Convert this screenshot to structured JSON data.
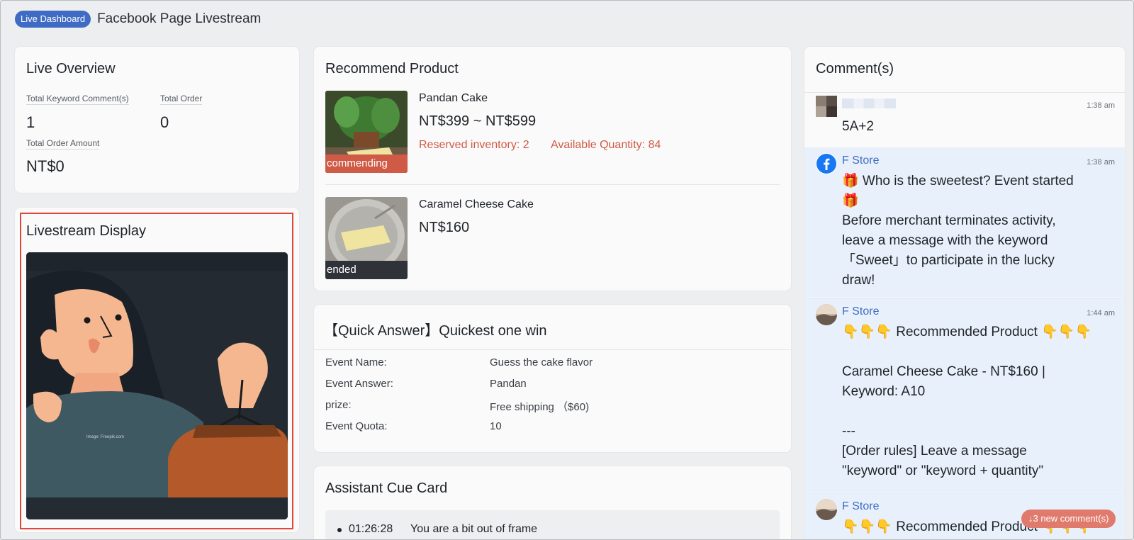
{
  "header": {
    "badge": "Live Dashboard",
    "title": "Facebook Page Livestream"
  },
  "overview": {
    "title": "Live Overview",
    "keyword_comments_label": "Total Keyword Comment(s)",
    "keyword_comments_value": "1",
    "total_order_label": "Total Order",
    "total_order_value": "0",
    "order_amount_label": "Total Order Amount",
    "order_amount_value": "NT$0"
  },
  "display": {
    "title": "Livestream Display",
    "watermark": "Image: Freepik.com"
  },
  "recommend": {
    "title": "Recommend Product",
    "products": [
      {
        "tag": "commending",
        "name": "Pandan Cake",
        "price": "NT$399 ~ NT$599",
        "reserved": "Reserved inventory: 2",
        "available": "Available Quantity: 84"
      },
      {
        "tag": "ended",
        "name": "Caramel Cheese Cake",
        "price": "NT$160"
      }
    ]
  },
  "quick": {
    "title": "【Quick Answer】Quickest one win",
    "rows": [
      {
        "label": "Event Name:",
        "value": "Guess the cake flavor"
      },
      {
        "label": "Event Answer:",
        "value": "Pandan"
      },
      {
        "label": "prize:",
        "value": "Free shipping （$60)"
      },
      {
        "label": "Event Quota:",
        "value": "10"
      }
    ]
  },
  "cue": {
    "title": "Assistant Cue Card",
    "time": "01:26:28",
    "text": "You are a bit out of frame"
  },
  "comments": {
    "title": "Comment(s)",
    "items": [
      {
        "name": "",
        "time": "1:38 am",
        "text": "5A+2"
      },
      {
        "name": "F Store",
        "time": "1:38 am",
        "text": "🎁 Who is the sweetest? Event started\n🎁\nBefore merchant terminates activity,\nleave a message with the keyword\n「Sweet」to participate in the lucky\ndraw!"
      },
      {
        "name": "F Store",
        "time": "1:44 am",
        "text": "👇👇👇 Recommended Product 👇👇👇\n\nCaramel Cheese Cake - NT$160 |\nKeyword: A10\n\n---\n[Order rules] Leave a message\n\"keyword\" or \"keyword + quantity\""
      },
      {
        "name": "F Store",
        "time": "",
        "text": "👇👇👇 Recommended Product 👇👇👇"
      }
    ],
    "new_button": "↓3 new comment(s)"
  },
  "colors": {
    "accent": "#3f6bc4",
    "alert": "#cf5a46",
    "highlight": "#e8f1fb"
  }
}
